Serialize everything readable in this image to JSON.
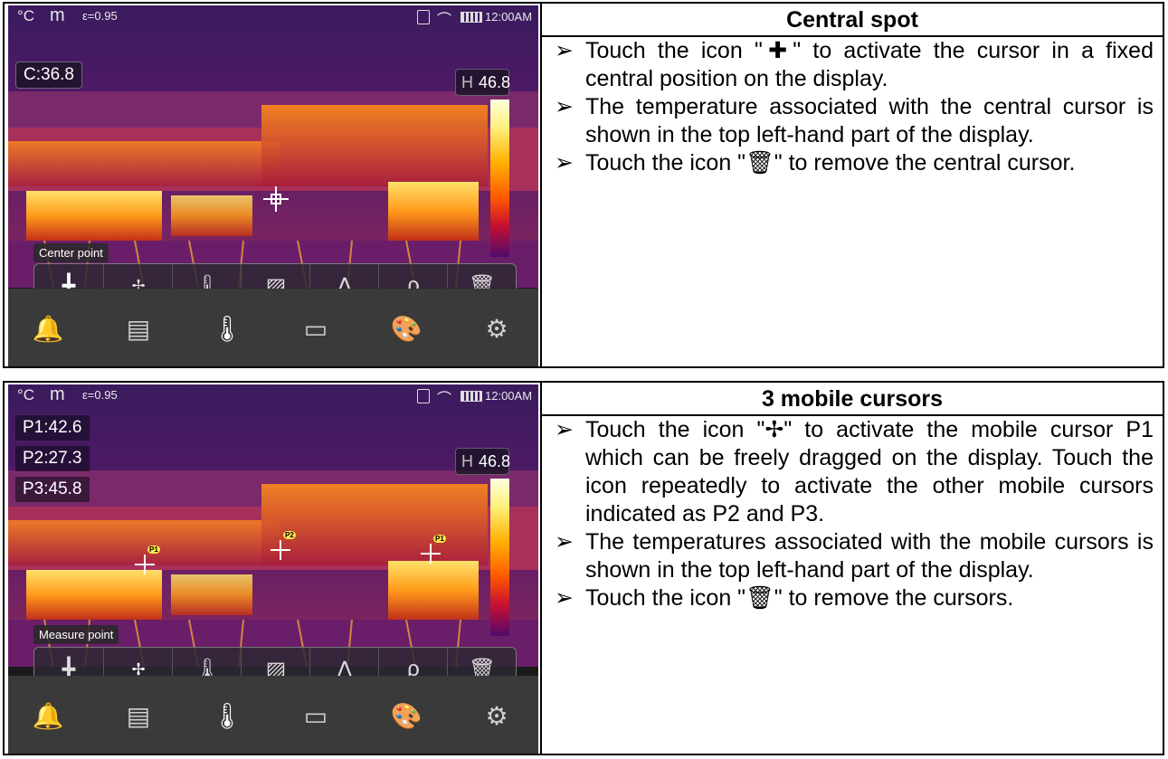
{
  "sections": [
    {
      "title": "Central spot",
      "device": {
        "status": {
          "unit": "°C",
          "mode": "m",
          "emissivity": "ε=0.95",
          "time": "12:00AM"
        },
        "readouts": [
          "C:36.8"
        ],
        "max_label": "H",
        "max_value": "46.8",
        "hint": "Center point"
      },
      "bullets": [
        "Touch the icon \"✚\" to activate the cursor in a fixed central position on the display.",
        "The temperature associated with the central cursor is shown in the top left-hand part of the display.",
        "Touch the icon \"🗑\" to remove the central cursor."
      ]
    },
    {
      "title": "3 mobile cursors",
      "device": {
        "status": {
          "unit": "°C",
          "mode": "m",
          "emissivity": "ε=0.95",
          "time": "12:00AM"
        },
        "readouts": [
          "P1:42.6",
          "P2:27.3",
          "P3:45.8"
        ],
        "max_label": "H",
        "max_value": "46.8",
        "hint": "Measure point",
        "cursor_tags": [
          "P1",
          "P2",
          "P1"
        ]
      },
      "bullets": [
        "Touch the icon \"✢\" to activate the mobile cursor P1 which can be freely dragged on the display. Touch the icon repeatedly to activate the other mobile cursors indicated as P2 and P3.",
        "The temperatures associated with the mobile cursors is shown in the top left-hand part of the display.",
        "Touch the icon \"🗑\" to remove the cursors."
      ]
    }
  ],
  "toolbar_icons": [
    "center-spot-icon",
    "mobile-cursors-icon",
    "hot-cold-icon",
    "area-icon",
    "line-icon",
    "voice-icon",
    "trash-icon"
  ],
  "nav_icons": [
    "alarm-bell-icon",
    "display-icon",
    "thermometer-icon",
    "image-icon",
    "palette-icon",
    "settings-icon"
  ],
  "bullet_marker": "➢"
}
